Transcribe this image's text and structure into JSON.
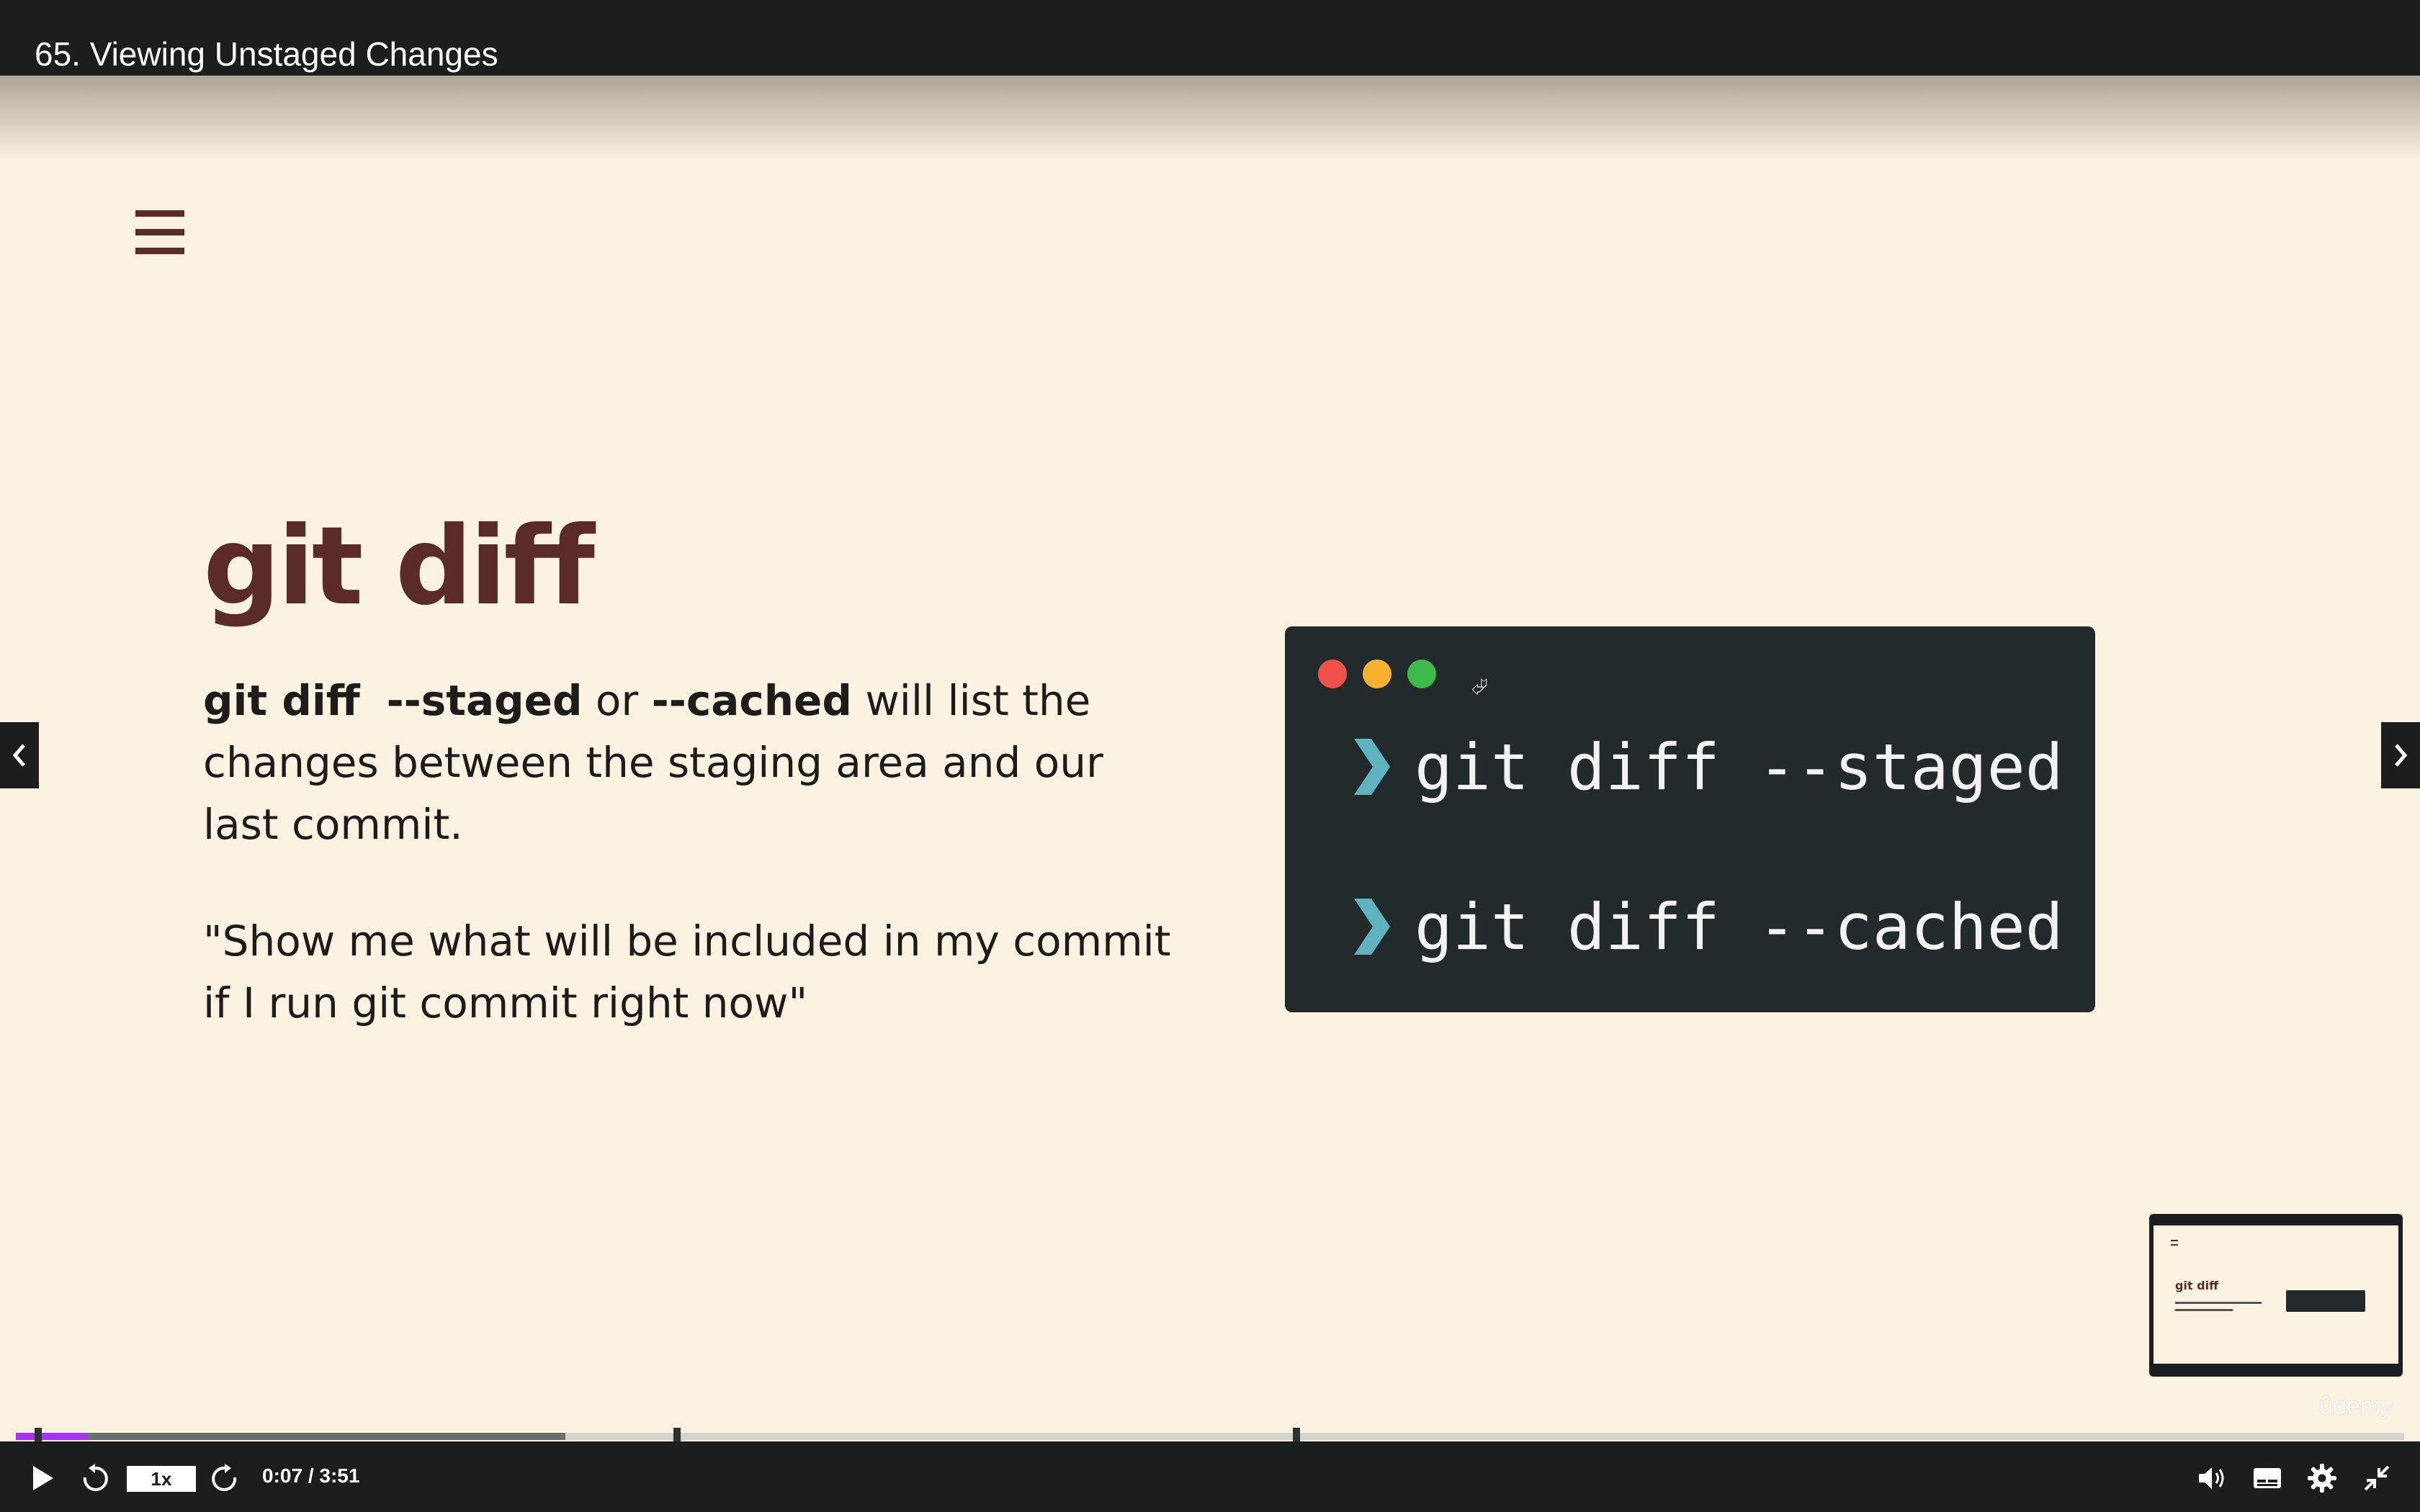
{
  "header": {
    "lecture_title": "65. Viewing Unstaged Changes"
  },
  "slide": {
    "title": "git diff",
    "description": {
      "cmd": "git diff",
      "flag1": "--staged",
      "or": "or",
      "flag2": "--cached",
      "rest": "will list the changes between the staging area and our last commit."
    },
    "quote": "\"Show me what will be included in my commit\n if I run git commit right now\""
  },
  "terminal": {
    "commands": [
      "git diff --staged",
      "git diff --cached"
    ]
  },
  "thumbnail": {
    "title": "git diff"
  },
  "watermark": "ûdemy",
  "player": {
    "speed": "1x",
    "time": "0:07 / 3:51",
    "progress_fraction": 0.03,
    "buffered_fraction": 0.23
  },
  "colors": {
    "slide_background": "#fbf2e2",
    "title_color": "#5a2b28",
    "terminal_background": "#232a2c",
    "chevron_color": "#5fb3be",
    "progress_played": "#a435f0"
  },
  "icons": {
    "menu": "hamburger-menu-icon",
    "prev": "chevron-left-icon",
    "next": "chevron-right-icon",
    "play": "play-icon",
    "rewind": "rewind-5-icon",
    "forward": "forward-5-icon",
    "volume": "volume-icon",
    "captions": "captions-icon",
    "settings": "gear-icon",
    "exit_fullscreen": "exit-fullscreen-icon"
  }
}
